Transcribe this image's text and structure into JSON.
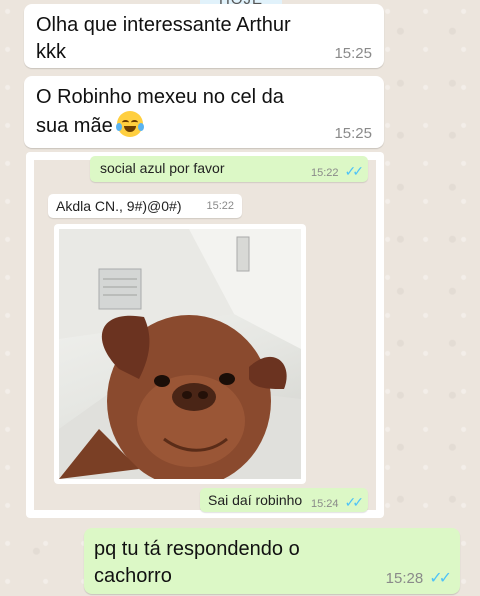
{
  "date_divider": "HOJE",
  "messages": [
    {
      "text": "Olha que interessante Arthur\nkkk",
      "time": "15:25"
    },
    {
      "text": "O Robinho mexeu no cel da\nsua mãe",
      "time": "15:25"
    },
    {
      "text": "pq tu tá respondendo o\ncachorro",
      "time": "15:28"
    }
  ],
  "screenshot": {
    "top_message": {
      "text": "social azul por favor",
      "time": "15:22"
    },
    "incoming": {
      "text": "Akdla CN., 9#)@0#)",
      "time": "15:22"
    },
    "outgoing": {
      "text": "Sai daí robinho",
      "time": "15:24"
    }
  },
  "colors": {
    "outgoing_bubble": "#dcf8c6",
    "incoming_bubble": "#ffffff",
    "chat_background": "#ece5dd",
    "read_ticks": "#4fc3f7"
  },
  "icons": [
    "double-check-icon",
    "tears-of-joy-emoji"
  ]
}
